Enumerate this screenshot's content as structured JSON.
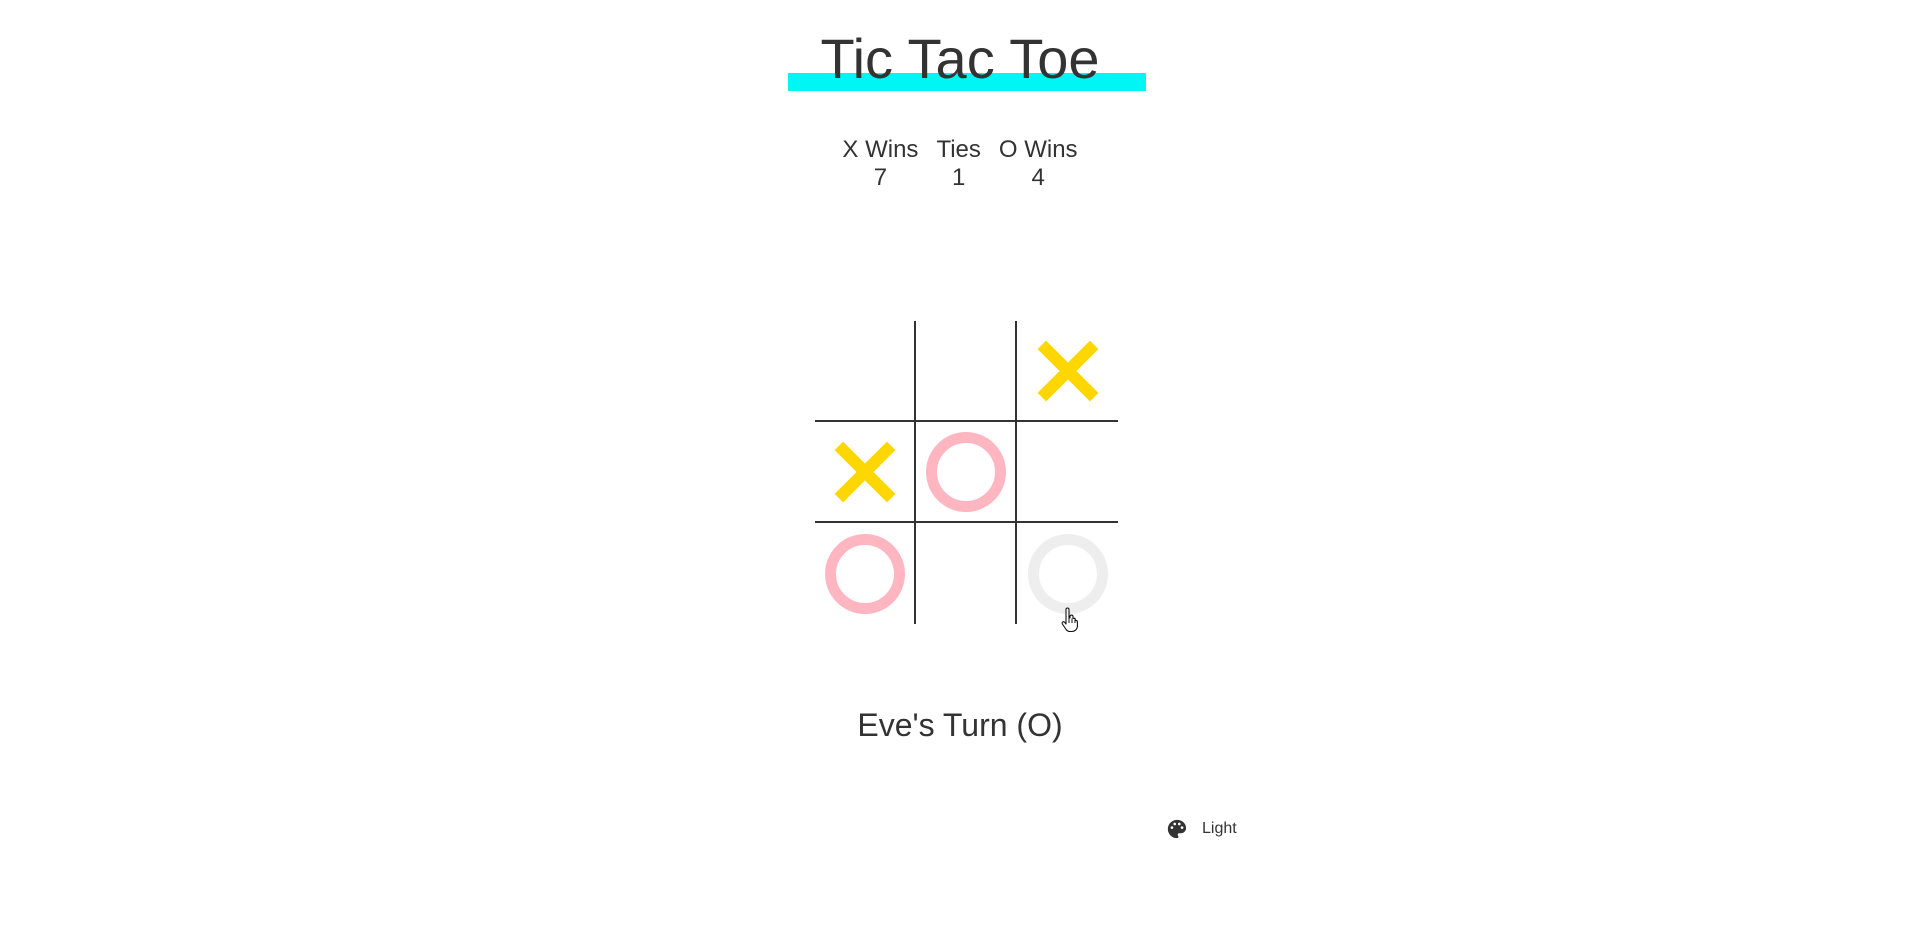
{
  "title": "Tic Tac Toe",
  "colors": {
    "title_underline": "#00f5f5",
    "x_mark": "#ffd700",
    "o_mark": "#ffb6c1",
    "o_preview": "#eeeeee",
    "grid": "#333333",
    "text": "#333333"
  },
  "scores": {
    "x": {
      "label": "X Wins",
      "value": "7"
    },
    "ties": {
      "label": "Ties",
      "value": "1"
    },
    "o": {
      "label": "O Wins",
      "value": "4"
    }
  },
  "board": [
    [
      "",
      "",
      "X"
    ],
    [
      "X",
      "O",
      ""
    ],
    [
      "O",
      "",
      "O-preview"
    ]
  ],
  "status": "Eve's Turn (O)",
  "theme_toggle": {
    "icon": "palette-icon",
    "label": "Light"
  }
}
